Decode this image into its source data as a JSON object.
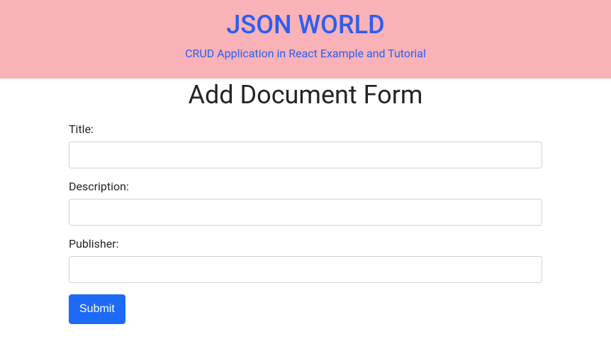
{
  "header": {
    "title": "JSON WORLD",
    "subtitle": "CRUD Application in React Example and Tutorial"
  },
  "page": {
    "title": "Add Document Form"
  },
  "form": {
    "fields": {
      "title": {
        "label": "Title:",
        "value": ""
      },
      "description": {
        "label": "Description:",
        "value": ""
      },
      "publisher": {
        "label": "Publisher:",
        "value": ""
      }
    },
    "submit_label": "Submit"
  }
}
